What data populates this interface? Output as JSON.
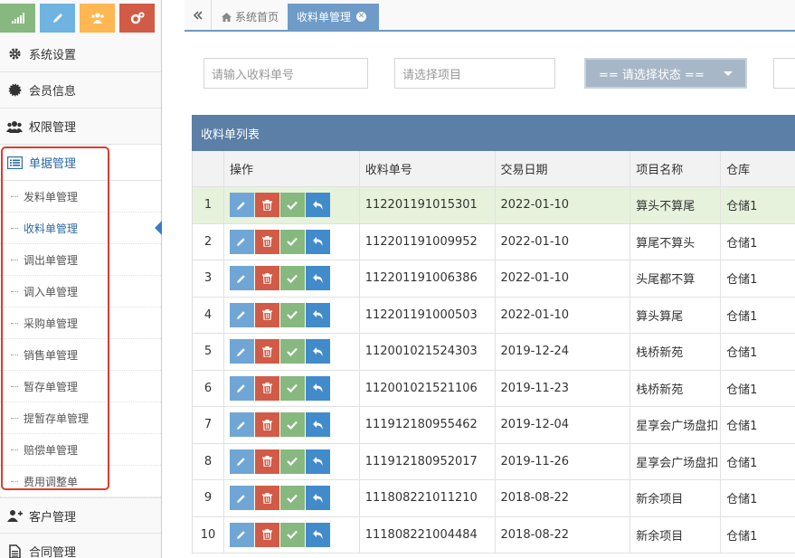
{
  "colors": {
    "shortcut_1": "#87b87f",
    "shortcut_2": "#6fb3e0",
    "shortcut_3": "#ffb752",
    "shortcut_4": "#d15b47",
    "panel_header": "#5b7fa6",
    "active_tab": "#6e9bc8",
    "selected_row": "#e7f2dc",
    "highlight_frame": "#e0392b"
  },
  "shortcuts": [
    {
      "icon": "signal-icon"
    },
    {
      "icon": "pencil-icon"
    },
    {
      "icon": "users-icon"
    },
    {
      "icon": "cogs-icon"
    }
  ],
  "sidebar": {
    "top_items": [
      {
        "label": "系统设置",
        "icon": "gear-icon"
      },
      {
        "label": "会员信息",
        "icon": "badge-icon"
      },
      {
        "label": "权限管理",
        "icon": "group-icon"
      }
    ],
    "active_section": {
      "label": "单据管理",
      "icon": "list-icon"
    },
    "sub_items": [
      {
        "label": "发料单管理"
      },
      {
        "label": "收料单管理"
      },
      {
        "label": "调出单管理"
      },
      {
        "label": "调入单管理"
      },
      {
        "label": "采购单管理"
      },
      {
        "label": "销售单管理"
      },
      {
        "label": "暂存单管理"
      },
      {
        "label": "提暂存单管理"
      },
      {
        "label": "赔偿单管理"
      },
      {
        "label": "费用调整单"
      }
    ],
    "bottom_items": [
      {
        "label": "客户管理",
        "icon": "user-plus-icon"
      },
      {
        "label": "合同管理",
        "icon": "file-icon"
      }
    ]
  },
  "tabs": {
    "home_label": "系统首页",
    "current_label": "收料单管理"
  },
  "search": {
    "order_no_placeholder": "请输入收料单号",
    "project_placeholder": "请选择项目",
    "status_selected": "== 请选择状态 =="
  },
  "table": {
    "title": "收料单列表",
    "columns": {
      "ops": "操作",
      "order_no": "收料单号",
      "date": "交易日期",
      "project": "项目名称",
      "warehouse": "仓库"
    },
    "rows": [
      {
        "idx": "1",
        "order_no": "112201191015301",
        "date": "2022-01-10",
        "project": "算头不算尾",
        "warehouse": "仓储1"
      },
      {
        "idx": "2",
        "order_no": "112201191009952",
        "date": "2022-01-10",
        "project": "算尾不算头",
        "warehouse": "仓储1"
      },
      {
        "idx": "3",
        "order_no": "112201191006386",
        "date": "2022-01-10",
        "project": "头尾都不算",
        "warehouse": "仓储1"
      },
      {
        "idx": "4",
        "order_no": "112201191000503",
        "date": "2022-01-10",
        "project": "算头算尾",
        "warehouse": "仓储1"
      },
      {
        "idx": "5",
        "order_no": "112001021524303",
        "date": "2019-12-24",
        "project": "栈桥新苑",
        "warehouse": "仓储1"
      },
      {
        "idx": "6",
        "order_no": "112001021521106",
        "date": "2019-11-23",
        "project": "栈桥新苑",
        "warehouse": "仓储1"
      },
      {
        "idx": "7",
        "order_no": "111912180955462",
        "date": "2019-12-04",
        "project": "星享会广场盘扣",
        "warehouse": "仓储1"
      },
      {
        "idx": "8",
        "order_no": "111912180952017",
        "date": "2019-11-26",
        "project": "星享会广场盘扣",
        "warehouse": "仓储1"
      },
      {
        "idx": "9",
        "order_no": "111808221011210",
        "date": "2018-08-22",
        "project": "新余项目",
        "warehouse": "仓储1"
      },
      {
        "idx": "10",
        "order_no": "111808221004484",
        "date": "2018-08-22",
        "project": "新余项目",
        "warehouse": "仓储1"
      }
    ]
  }
}
